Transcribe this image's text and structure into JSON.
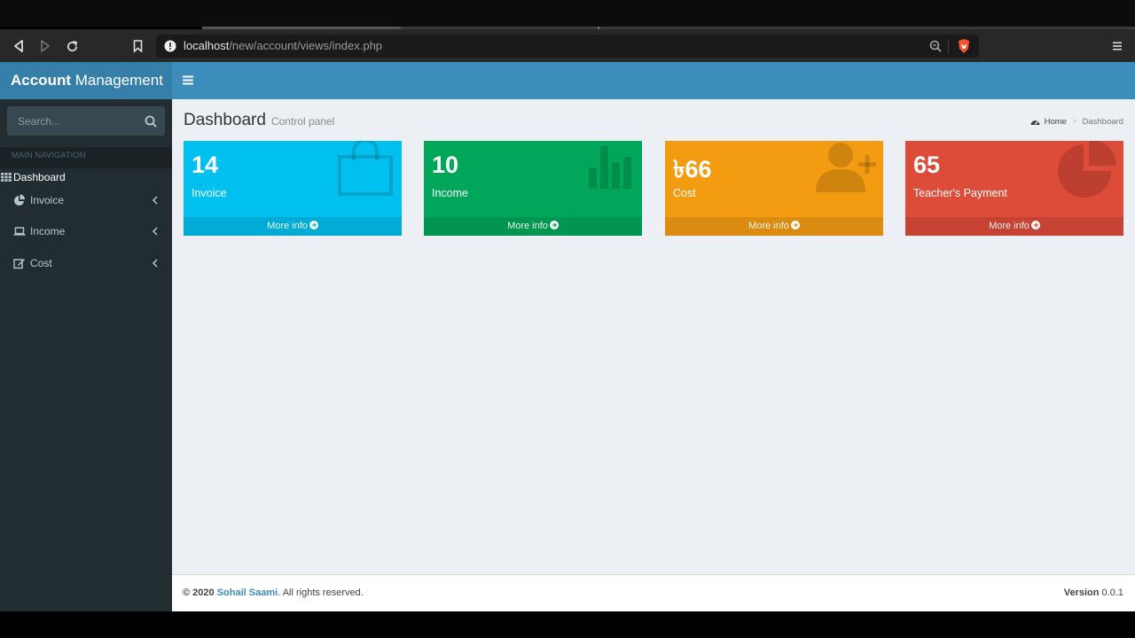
{
  "browser": {
    "url_host": "localhost",
    "url_path": "/new/account/views/index.php"
  },
  "sidebar": {
    "logo_bold": "Account",
    "logo_rest": " Management",
    "search_placeholder": "Search...",
    "nav_header": "MAIN NAVIGATION",
    "active_item": "Dashboard",
    "items": [
      {
        "label": "Invoice",
        "icon": "pie-chart-icon"
      },
      {
        "label": "Income",
        "icon": "laptop-icon"
      },
      {
        "label": "Cost",
        "icon": "edit-icon"
      }
    ]
  },
  "content": {
    "title": "Dashboard",
    "subtitle": "Control panel",
    "breadcrumb": {
      "home": "Home",
      "separator": ">",
      "current": "Dashboard"
    }
  },
  "boxes": [
    {
      "value": "14",
      "label": "Invoice",
      "footer": "More info",
      "color": "#00c0ef",
      "icon": "shopping-bag-icon"
    },
    {
      "value": "10",
      "label": "Income",
      "footer": "More info",
      "color": "#00a65a",
      "icon": "bar-chart-icon"
    },
    {
      "value": "৳66",
      "label": "Cost",
      "footer": "More info",
      "color": "#f39c12",
      "icon": "user-plus-icon"
    },
    {
      "value": "65",
      "label": "Teacher's Payment",
      "footer": "More info",
      "color": "#dd4b39",
      "icon": "pie-chart-icon"
    }
  ],
  "footer": {
    "copyright": "© 2020 ",
    "author": "Sohail Saami",
    "rights": ". All rights reserved.",
    "version_label": "Version",
    "version": " 0.0.1"
  }
}
